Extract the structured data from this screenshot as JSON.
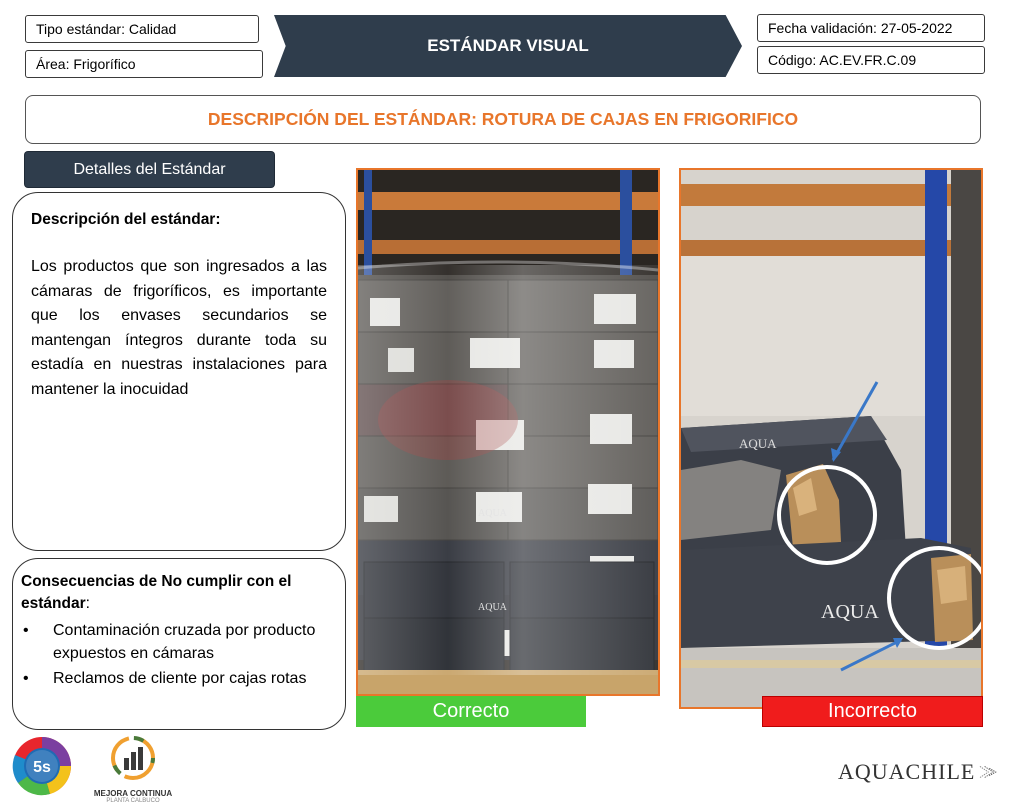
{
  "header": {
    "tipo_estandar": "Tipo estándar: Calidad",
    "area": "Área: Frigorífico",
    "title": "ESTÁNDAR VISUAL",
    "fecha_validacion": "Fecha validación: 27-05-2022",
    "codigo": "Código: AC.EV.FR.C.09"
  },
  "description_title": "DESCRIPCIÓN DEL ESTÁNDAR: ROTURA DE CAJAS EN FRIGORIFICO",
  "details_button": "Detalles del Estándar",
  "description": {
    "heading": "Descripción del estándar:",
    "body": "Los productos que son ingresados a las cámaras de frigoríficos, es importante que los envases secundarios se mantengan íntegros durante toda su estadía en nuestras instalaciones para mantener la inocuidad"
  },
  "consequences": {
    "heading": "Consecuencias de No cumplir con el estándar",
    "heading_suffix": ":",
    "bullet": "•",
    "items": [
      "Contaminación cruzada por producto expuestos en cámaras",
      "Reclamos de cliente por cajas rotas"
    ]
  },
  "photos": {
    "correct_label": "Correcto",
    "incorrect_label": "Incorrecto",
    "box_brand": "AQUA"
  },
  "logos": {
    "five_s": "5s",
    "mejora_continua": "MEJORA CONTINUA",
    "mejora_sub": "PLANTA CALBUCO",
    "aquachile": "AQUACHILE"
  },
  "colors": {
    "navy": "#2f3d4c",
    "orange": "#e8762b",
    "green": "#4bcb3b",
    "red": "#f01c1c"
  }
}
